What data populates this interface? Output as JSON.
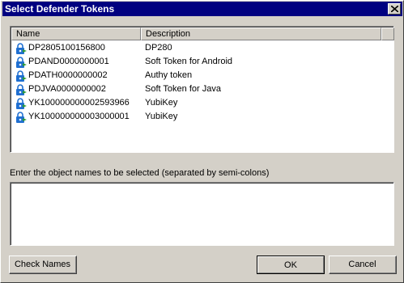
{
  "window": {
    "title": "Select Defender Tokens"
  },
  "list": {
    "columns": {
      "name": "Name",
      "description": "Description"
    },
    "rows": [
      {
        "name": "DP2805100156800",
        "description": "DP280",
        "icon": "token-icon"
      },
      {
        "name": "PDAND0000000001",
        "description": "Soft Token for Android",
        "icon": "token-icon"
      },
      {
        "name": "PDATH0000000002",
        "description": "Authy token",
        "icon": "token-icon"
      },
      {
        "name": "PDJVA0000000002",
        "description": "Soft Token for Java",
        "icon": "token-icon"
      },
      {
        "name": "YK100000000002593966",
        "description": "YubiKey",
        "icon": "token-icon"
      },
      {
        "name": "YK100000000003000001",
        "description": "YubiKey",
        "icon": "token-icon"
      }
    ]
  },
  "prompt": "Enter the object names to be selected (separated by semi-colons)",
  "input": {
    "value": ""
  },
  "buttons": {
    "check_names": "Check Names",
    "ok": "OK",
    "cancel": "Cancel"
  },
  "colors": {
    "titlebar": "#000080",
    "face": "#d4d0c8",
    "icon_blue": "#1f6fd1",
    "icon_green": "#2e9a3a"
  }
}
